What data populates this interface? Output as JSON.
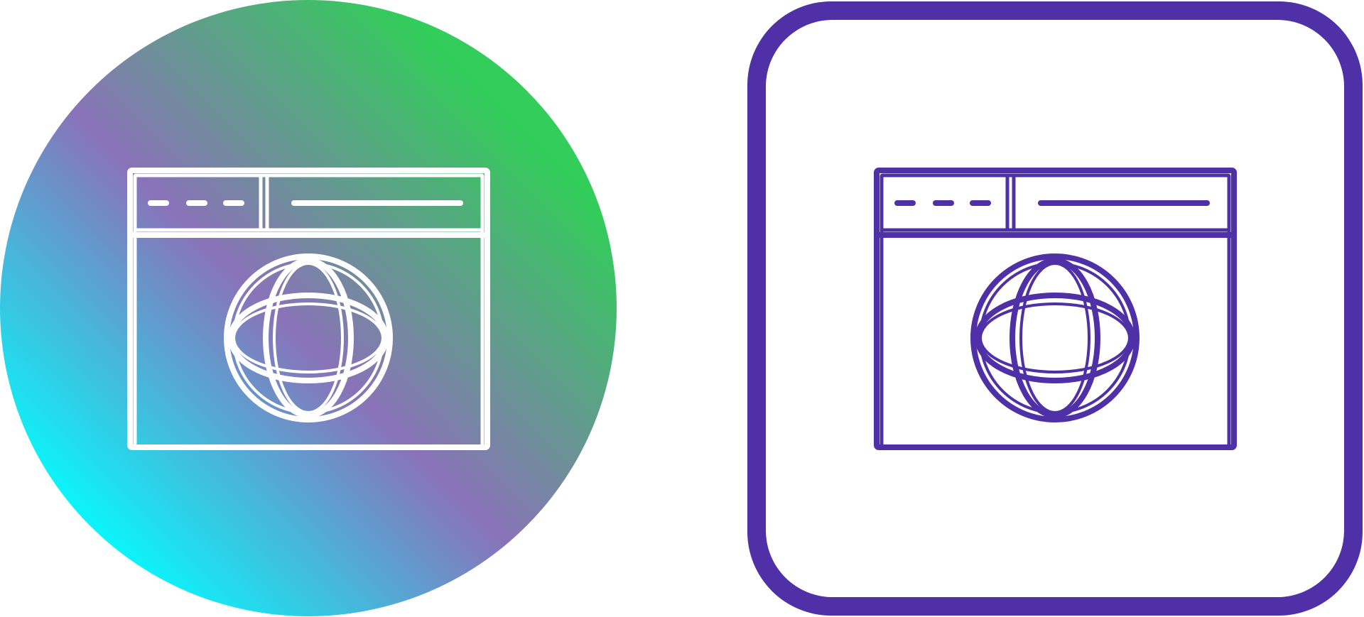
{
  "icons": [
    {
      "name": "web-browser-globe-icon",
      "style": "gradient-circle",
      "line_color": "#ffffff",
      "gradient": {
        "start": "#00ffff",
        "middle": "#8a72b8",
        "end": "#32cd5a"
      }
    },
    {
      "name": "web-browser-globe-icon",
      "style": "outline-rounded-square",
      "line_color": "#5030a6",
      "frame_color": "#5030a6",
      "background": "#ffffff"
    }
  ]
}
